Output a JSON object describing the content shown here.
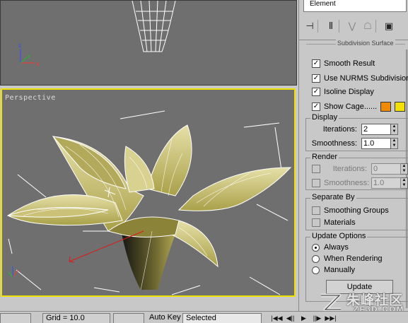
{
  "top_panel": {
    "list_item": "Element"
  },
  "viewports": {
    "perspective_label": "Perspective"
  },
  "command_panel": {
    "rollout_title": "Subdivision Surface",
    "checks": [
      {
        "label": "Smooth Result",
        "checked": true
      },
      {
        "label": "Use NURMS Subdivision",
        "checked": true
      },
      {
        "label": "Isoline Display",
        "checked": true
      },
      {
        "label": "Show Cage......",
        "checked": true
      }
    ],
    "cage_colors": [
      "#f08a00",
      "#f4e000"
    ],
    "display": {
      "title": "Display",
      "iterations_label": "Iterations:",
      "iterations_value": "2",
      "smoothness_label": "Smoothness:",
      "smoothness_value": "1.0"
    },
    "render": {
      "title": "Render",
      "iterations_label": "Iterations:",
      "iterations_value": "0",
      "smoothness_label": "Smoothness:",
      "smoothness_value": "1.0"
    },
    "separate_by": {
      "title": "Separate By",
      "smoothing_groups": "Smoothing Groups",
      "materials": "Materials"
    },
    "update_options": {
      "title": "Update Options",
      "always": "Always",
      "when_rendering": "When Rendering",
      "manually": "Manually",
      "update_button": "Update"
    }
  },
  "status_bar": {
    "grid": "Grid = 10.0",
    "auto_key": "Auto Key",
    "selected": "Selected"
  },
  "watermark": {
    "text": "朱峰社区",
    "url": "ZF3D.COM"
  }
}
